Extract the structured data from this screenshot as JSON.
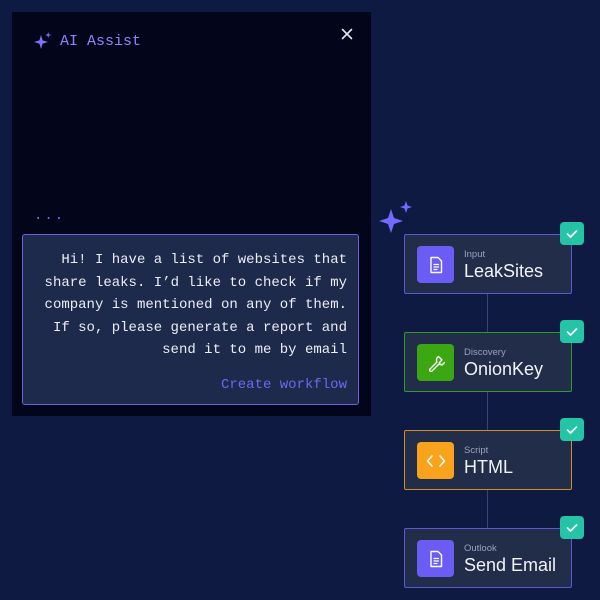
{
  "assist": {
    "title": "AI Assist",
    "typing_indicator": "...",
    "message_lines": [
      "Hi! I have a list of websites that",
      "share leaks. I’d like to check if my",
      "company is mentioned on any of them.",
      "If so, please generate a report and",
      "send it to me by email"
    ],
    "create_link": "Create workflow"
  },
  "workflow": {
    "nodes": [
      {
        "type": "Input",
        "name": "LeakSites",
        "icon": "document-icon",
        "color": "#6a5cf5",
        "completed": true
      },
      {
        "type": "Discovery",
        "name": "OnionKey",
        "icon": "wrench-icon",
        "color": "#3aa713",
        "completed": true
      },
      {
        "type": "Script",
        "name": "HTML",
        "icon": "code-icon",
        "color": "#f9a21c",
        "completed": true
      },
      {
        "type": "Outlook",
        "name": "Send Email",
        "icon": "document-icon",
        "color": "#6a5cf5",
        "completed": true
      }
    ]
  },
  "colors": {
    "background": "#0f1a42",
    "accent": "#6d68f0",
    "check": "#24c4a6"
  }
}
